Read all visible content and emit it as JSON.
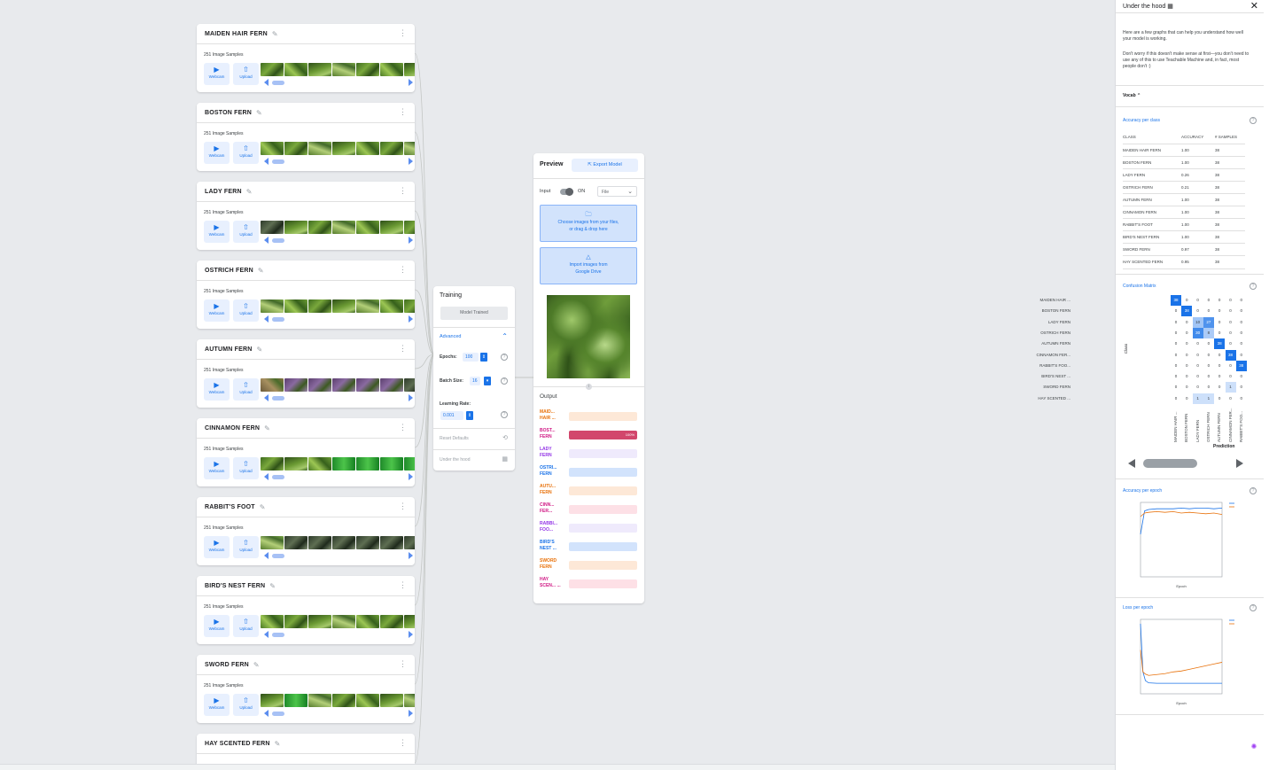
{
  "classes": [
    {
      "name": "MAIDEN HAIR FERN",
      "samples": "251 Image Samples",
      "thumb": [
        "g1",
        "g2",
        "g3",
        "g4",
        "g1",
        "g2",
        "g3"
      ]
    },
    {
      "name": "BOSTON FERN",
      "samples": "251 Image Samples",
      "thumb": [
        "g2",
        "g1",
        "g4",
        "g3",
        "g2",
        "g1",
        "g4"
      ]
    },
    {
      "name": "LADY FERN",
      "samples": "251 Image Samples",
      "thumb": [
        "d1",
        "g3",
        "g1",
        "g4",
        "g2",
        "g3",
        "g1"
      ]
    },
    {
      "name": "OSTRICH FERN",
      "samples": "251 Image Samples",
      "thumb": [
        "g4",
        "g2",
        "g1",
        "g3",
        "g4",
        "g2",
        "g1"
      ]
    },
    {
      "name": "AUTUMN FERN",
      "samples": "251 Image Samples",
      "thumb": [
        "p2",
        "p1",
        "p1",
        "p1",
        "p1",
        "p1",
        "d1"
      ]
    },
    {
      "name": "CINNAMON FERN",
      "samples": "251 Image Samples",
      "thumb": [
        "g1",
        "g3",
        "g2",
        "b1",
        "b1",
        "b1",
        "b1"
      ]
    },
    {
      "name": "RABBIT'S FOOT",
      "samples": "251 Image Samples",
      "thumb": [
        "g4",
        "d1",
        "d1",
        "d1",
        "d1",
        "d1",
        "d1"
      ]
    },
    {
      "name": "BIRD'S NEST FERN",
      "samples": "251 Image Samples",
      "thumb": [
        "g2",
        "g1",
        "g3",
        "g4",
        "g2",
        "g1",
        "g3"
      ]
    },
    {
      "name": "SWORD FERN",
      "samples": "251 Image Samples",
      "thumb": [
        "g3",
        "b1",
        "g4",
        "g1",
        "g2",
        "g3",
        "g4"
      ]
    },
    {
      "name": "HAY SCENTED FERN",
      "samples": "",
      "thumb": []
    }
  ],
  "card_buttons": {
    "webcam": "Webcam",
    "upload": "Upload"
  },
  "training": {
    "title": "Training",
    "button": "Model Trained",
    "advanced": "Advanced",
    "epochs_label": "Epochs:",
    "epochs_value": "100",
    "batch_label": "Batch Size:",
    "batch_value": "16",
    "lr_label": "Learning Rate:",
    "lr_value": "0.001",
    "reset": "Reset Defaults",
    "hood": "Under the hood"
  },
  "preview": {
    "title": "Preview",
    "export": "Export Model",
    "input_label": "Input",
    "toggle_state": "ON",
    "source": "File",
    "drop_line1": "Choose images from your files,",
    "drop_line2": "or drag & drop here",
    "drive_line1": "Import images from",
    "drive_line2": "Google Drive",
    "output_label": "Output",
    "outputs": [
      {
        "label": "MAID... HAIR ...",
        "color": "#e8710a",
        "bg": "#fde8d7",
        "value": 0
      },
      {
        "label": "BOST... FERN",
        "color": "#d01884",
        "bg": "#d2466c",
        "value": 100,
        "pct": "100%"
      },
      {
        "label": "LADY FERN",
        "color": "#9334e6",
        "bg": "#efeafc",
        "value": 0
      },
      {
        "label": "OSTRI... FERN",
        "color": "#1a73e8",
        "bg": "#d2e3fc",
        "value": 0
      },
      {
        "label": "AUTU... FERN",
        "color": "#e8710a",
        "bg": "#fde8d7",
        "value": 0
      },
      {
        "label": "CINN... FER...",
        "color": "#d01884",
        "bg": "#fde0e6",
        "value": 0
      },
      {
        "label": "RABBI... FOO...",
        "color": "#9334e6",
        "bg": "#efeafc",
        "value": 0
      },
      {
        "label": "BIRD'S NEST ...",
        "color": "#1a73e8",
        "bg": "#d2e3fc",
        "value": 0
      },
      {
        "label": "SWORD FERN",
        "color": "#e8710a",
        "bg": "#fde8d7",
        "value": 0
      },
      {
        "label": "HAY SCEN... ...",
        "color": "#d01884",
        "bg": "#fde0e6",
        "value": 0
      }
    ]
  },
  "hood": {
    "title": "Under the hood",
    "intro1": "Here are a few graphs that can help you understand how well your model is working.",
    "intro2": "Don't worry if this doesn't make sense at first—you don't need to use any of this to use Teachable Machine and, in fact, most people don't :)",
    "vocab": "Vocab",
    "acc_title": "Accuracy per class",
    "acc_headers": [
      "CLASS",
      "ACCURACY",
      "# SAMPLES"
    ],
    "acc_rows": [
      [
        "MAIDEN HAIR FERN",
        "1.00",
        "38"
      ],
      [
        "BOSTON FERN",
        "1.00",
        "38"
      ],
      [
        "LADY FERN",
        "0.26",
        "38"
      ],
      [
        "OSTRICH FERN",
        "0.21",
        "38"
      ],
      [
        "AUTUMN FERN",
        "1.00",
        "38"
      ],
      [
        "CINNAMON FERN",
        "1.00",
        "38"
      ],
      [
        "RABBIT'S FOOT",
        "1.00",
        "38"
      ],
      [
        "BIRD'S NEST FERN",
        "1.00",
        "38"
      ],
      [
        "SWORD FERN",
        "0.97",
        "38"
      ],
      [
        "HAY SCENTED FERN",
        "0.95",
        "38"
      ]
    ],
    "cm_title": "Confusion Matrix",
    "cm_rows": [
      "MAIDEN HAIR ...",
      "BOSTON FERN",
      "LADY FERN",
      "OSTRICH FERN",
      "AUTUMN FERN",
      "CINNAMON FER...",
      "RABBIT'S FOO...",
      "BIRD'S NEST ...",
      "SWORD FERN",
      "HAY SCENTED ..."
    ],
    "cm_cols": [
      "MAIDEN HAIR ...",
      "BOSTON FERN",
      "LADY FERN",
      "OSTRICH FERN",
      "AUTUMN FERN",
      "CINNAMON FER...",
      "RABBIT'S FOO..."
    ],
    "cm_values": [
      [
        38,
        0,
        0,
        0,
        0,
        0,
        0
      ],
      [
        0,
        38,
        0,
        0,
        0,
        0,
        0
      ],
      [
        0,
        0,
        10,
        27,
        0,
        0,
        0
      ],
      [
        0,
        0,
        30,
        8,
        0,
        0,
        0
      ],
      [
        0,
        0,
        0,
        0,
        38,
        0,
        0
      ],
      [
        0,
        0,
        0,
        0,
        0,
        38,
        0
      ],
      [
        0,
        0,
        0,
        0,
        0,
        0,
        38
      ],
      [
        0,
        0,
        0,
        0,
        0,
        0,
        0
      ],
      [
        0,
        0,
        0,
        0,
        0,
        1,
        0
      ],
      [
        0,
        0,
        1,
        1,
        0,
        0,
        0
      ]
    ],
    "cm_xlabel": "Prediction",
    "cm_ylabel": "Class",
    "ape_title": "Accuracy per epoch",
    "lpe_title": "Loss per epoch"
  },
  "chart_data": [
    {
      "type": "line",
      "title": "Accuracy per epoch",
      "xlabel": "Epoch",
      "ylim": [
        0,
        1
      ],
      "series": [
        {
          "name": "",
          "color": "#1a73e8",
          "x": [
            0,
            5,
            10,
            20,
            30,
            40,
            50,
            60,
            70,
            80,
            90,
            100
          ],
          "values": [
            0.6,
            0.93,
            0.95,
            0.96,
            0.96,
            0.96,
            0.97,
            0.96,
            0.97,
            0.97,
            0.96,
            0.97
          ]
        },
        {
          "name": "",
          "color": "#e8710a",
          "x": [
            0,
            5,
            10,
            20,
            30,
            40,
            50,
            60,
            70,
            80,
            90,
            100
          ],
          "values": [
            0.85,
            0.9,
            0.91,
            0.92,
            0.91,
            0.92,
            0.9,
            0.91,
            0.9,
            0.89,
            0.9,
            0.88
          ]
        }
      ]
    },
    {
      "type": "line",
      "title": "Loss per epoch",
      "xlabel": "Epoch",
      "series": [
        {
          "name": "",
          "color": "#1a73e8",
          "x": [
            0,
            3,
            6,
            10,
            20,
            30,
            40,
            50,
            60,
            70,
            80,
            90,
            100
          ],
          "values": [
            1.6,
            0.5,
            0.3,
            0.25,
            0.24,
            0.24,
            0.24,
            0.24,
            0.24,
            0.24,
            0.24,
            0.24,
            0.24
          ]
        },
        {
          "name": "",
          "color": "#e8710a",
          "x": [
            0,
            3,
            6,
            10,
            20,
            30,
            40,
            50,
            60,
            70,
            80,
            90,
            100
          ],
          "values": [
            1.0,
            0.5,
            0.45,
            0.42,
            0.44,
            0.46,
            0.5,
            0.52,
            0.56,
            0.6,
            0.64,
            0.68,
            0.72
          ]
        }
      ]
    }
  ]
}
